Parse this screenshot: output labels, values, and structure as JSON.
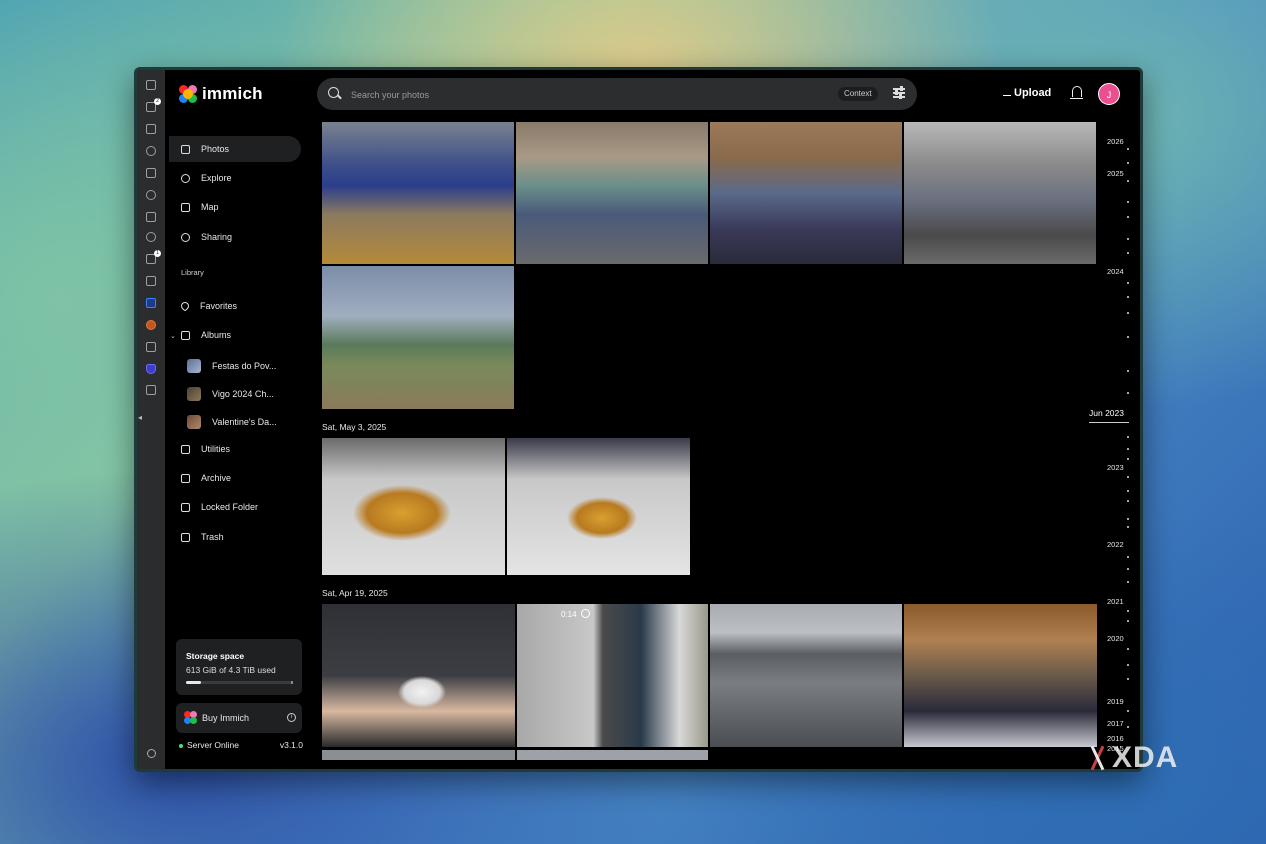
{
  "app": {
    "name": "immich"
  },
  "search": {
    "placeholder": "Search your photos",
    "context_label": "Context"
  },
  "header": {
    "upload_label": "Upload",
    "avatar_initial": "J"
  },
  "rail": {
    "badges": [
      "2",
      "1"
    ]
  },
  "sidebar": {
    "items": [
      {
        "label": "Photos",
        "icon": "photos-icon",
        "active": true
      },
      {
        "label": "Explore",
        "icon": "search-icon"
      },
      {
        "label": "Map",
        "icon": "map-icon"
      },
      {
        "label": "Sharing",
        "icon": "people-icon"
      }
    ],
    "library_label": "Library",
    "library_items": [
      {
        "label": "Favorites",
        "icon": "heart-icon"
      },
      {
        "label": "Albums",
        "icon": "album-icon"
      }
    ],
    "albums": [
      {
        "label": "Festas do Pov..."
      },
      {
        "label": "Vigo 2024 Ch..."
      },
      {
        "label": "Valentine's Da..."
      }
    ],
    "more_items": [
      {
        "label": "Utilities",
        "icon": "toolbox-icon"
      },
      {
        "label": "Archive",
        "icon": "archive-icon"
      },
      {
        "label": "Locked Folder",
        "icon": "lock-icon"
      },
      {
        "label": "Trash",
        "icon": "trash-icon"
      }
    ],
    "storage": {
      "title": "Storage space",
      "usage": "613 GiB of 4.3 TiB used",
      "used_fraction": 0.14
    },
    "buy_label": "Buy Immich",
    "server": {
      "status": "Server Online",
      "version": "v3.1.0"
    }
  },
  "timeline": {
    "dates": [
      "Sat, May 3, 2025",
      "Sat, Apr 19, 2025"
    ],
    "video_duration": "0:14",
    "current_label": "Jun 2023",
    "years": [
      "2026",
      "2025",
      "2024",
      "2023",
      "2022",
      "2021",
      "2020",
      "2019",
      "2017",
      "2016",
      "2015"
    ]
  },
  "watermark": {
    "text": "XDA"
  }
}
